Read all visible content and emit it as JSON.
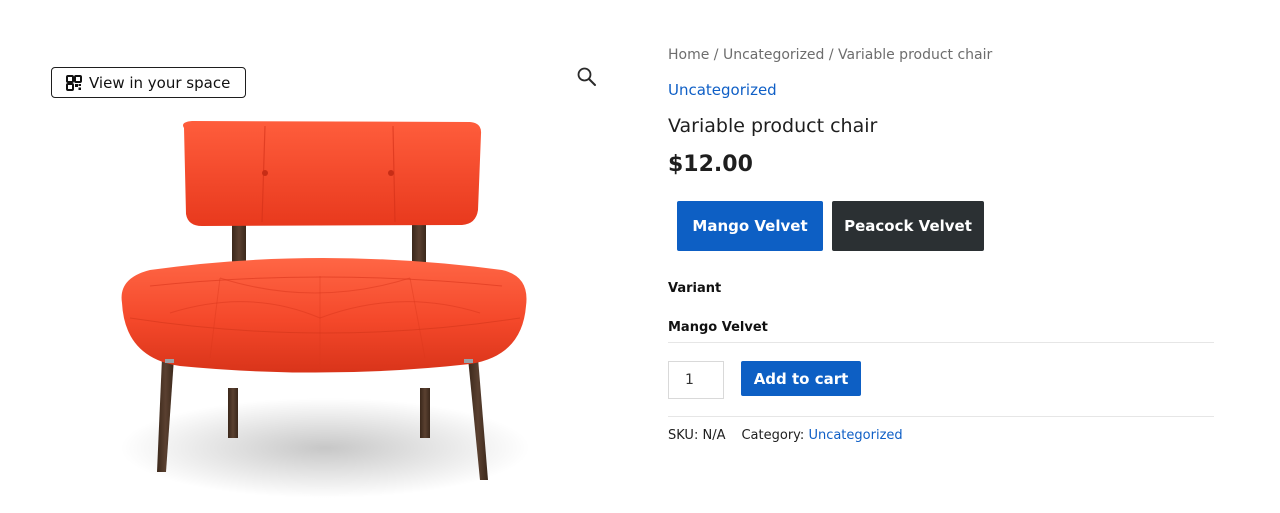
{
  "gallery": {
    "ar_button_label": "View in your space",
    "ar_icon": "qr-code-icon",
    "zoom_icon": "magnifier-icon",
    "image_alt": "Variable product chair",
    "chair_color": "#f44a2c",
    "leg_color": "#4a3424"
  },
  "breadcrumb": {
    "items": [
      "Home",
      "Uncategorized",
      "Variable product chair"
    ],
    "separator": " / "
  },
  "product": {
    "category_link": "Uncategorized",
    "title": "Variable product chair",
    "price": "$12.00"
  },
  "variations": {
    "swatches": [
      {
        "label": "Mango Velvet",
        "color": "#0d5fc4",
        "selected": true
      },
      {
        "label": "Peacock Velvet",
        "color": "#2b3033",
        "selected": false
      }
    ],
    "attribute_label": "Variant",
    "selected_value": "Mango Velvet"
  },
  "cart": {
    "quantity": "1",
    "add_button_label": "Add to cart"
  },
  "meta": {
    "sku_label": "SKU:",
    "sku_value": "N/A",
    "category_label": "Category:",
    "category_value": "Uncategorized"
  },
  "colors": {
    "accent": "#0d5fc4",
    "dark_button": "#2b3033",
    "link": "#0f5fc6"
  }
}
